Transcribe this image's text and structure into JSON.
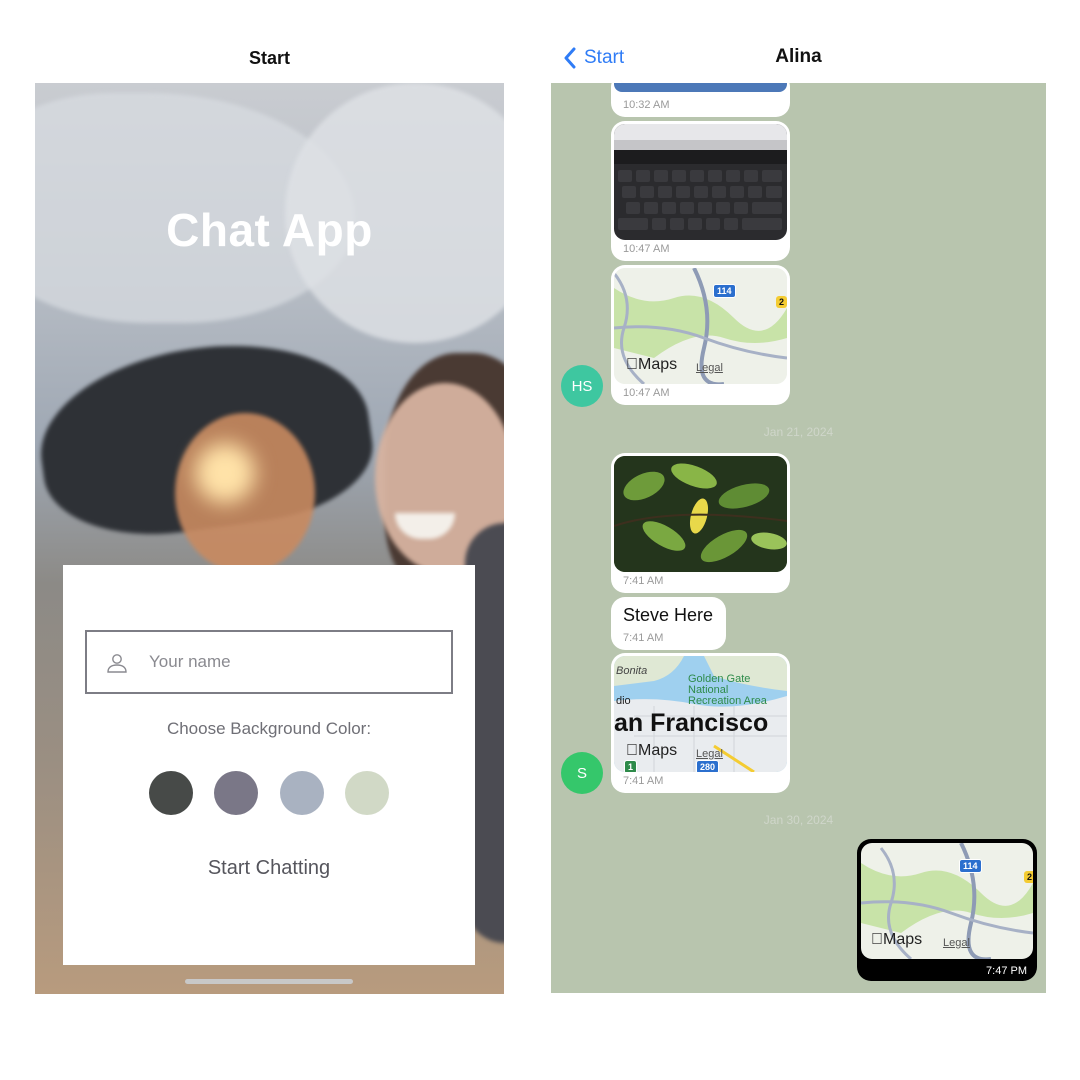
{
  "start_screen": {
    "nav_title": "Start",
    "app_title": "Chat App",
    "name_placeholder": "Your name",
    "name_value": "",
    "color_label": "Choose Background Color:",
    "swatches": [
      {
        "name": "color-swatch-charcoal",
        "color": "#474a48"
      },
      {
        "name": "color-swatch-slate",
        "color": "#7a7787"
      },
      {
        "name": "color-swatch-gray-blue",
        "color": "#a9b2c1"
      },
      {
        "name": "color-swatch-sage",
        "color": "#d1d9c6"
      }
    ],
    "start_button": "Start Chatting"
  },
  "chat_screen": {
    "back_label": "Start",
    "title": "Alina",
    "background_color": "#b8c5ae",
    "messages": [
      {
        "type": "image",
        "time": "10:32 AM"
      },
      {
        "type": "image",
        "time": "10:47 AM"
      },
      {
        "type": "map",
        "time": "10:47 AM",
        "map_brand": "Maps",
        "legal": "Legal",
        "highway": "114",
        "highway2": "2"
      },
      {
        "type": "date",
        "text": "Jan 21, 2024"
      },
      {
        "type": "image",
        "time": "7:41 AM"
      },
      {
        "type": "text",
        "text": "Steve Here",
        "time": "7:41 AM"
      },
      {
        "type": "map",
        "time": "7:41 AM",
        "map_brand": "Maps",
        "legal": "Legal",
        "city": "an Francisco",
        "area_label": "Golden Gate National Recreation Area",
        "place1": "Bonita",
        "place2": "dio",
        "highway": "280",
        "highway2": "1"
      },
      {
        "type": "date",
        "text": "Jan 30, 2024"
      },
      {
        "type": "map_sent",
        "time": "7:47 PM",
        "map_brand": "Maps",
        "legal": "Legal",
        "highway": "114",
        "highway2": "2"
      }
    ],
    "avatars": [
      {
        "initials": "HS",
        "color": "#3ec7a0"
      },
      {
        "initials": "S",
        "color": "#35c76b"
      }
    ]
  }
}
